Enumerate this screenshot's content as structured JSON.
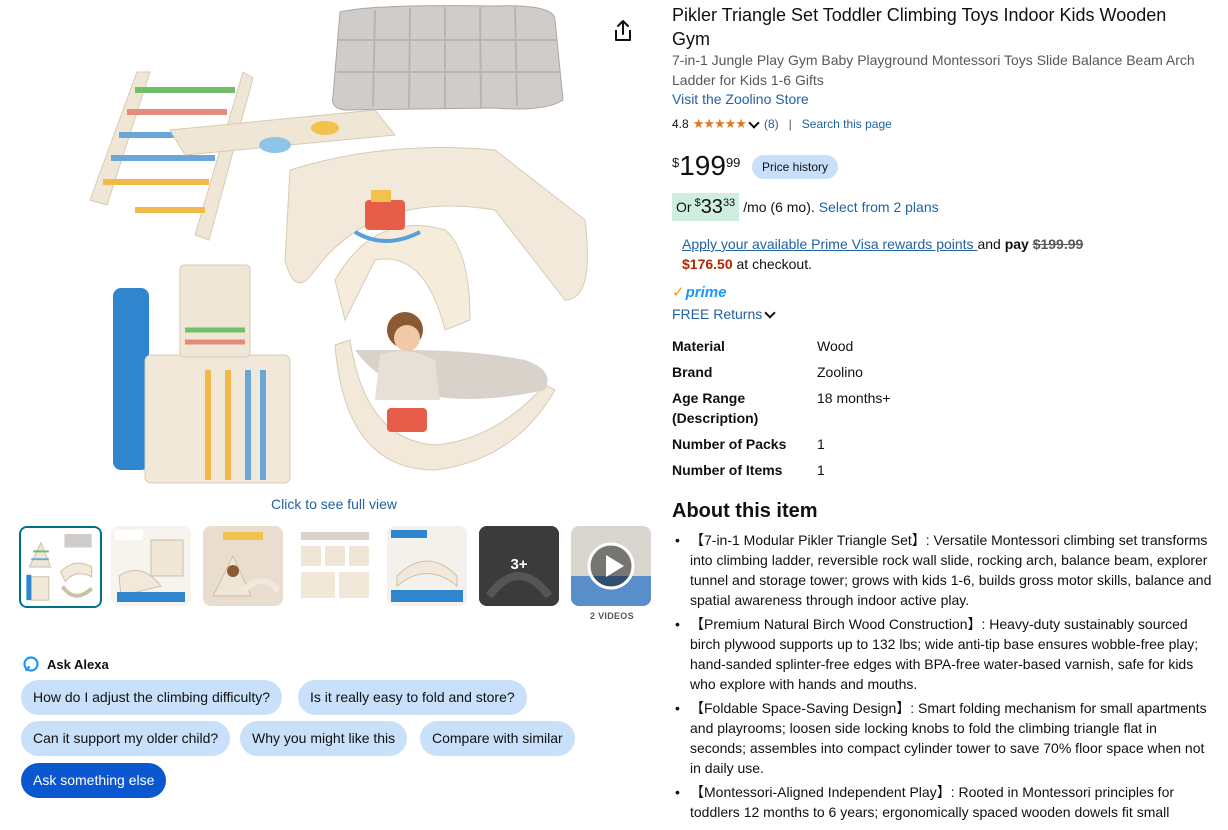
{
  "product": {
    "title": "Pikler Triangle Set Toddler Climbing Toys Indoor Kids Wooden Gym",
    "subtitle": "7-in-1 Jungle Play Gym Baby Playground Montessori Toys Slide Balance Beam Arch Ladder for Kids 1-6 Gifts",
    "store_link": "Visit the Zoolino Store",
    "rating": "4.8",
    "stars": "★★★★★",
    "rating_count": "(8)",
    "search_page": "Search this page"
  },
  "gallery": {
    "full_view": "Click to see full view",
    "more_label": "3+",
    "videos_label": "2 VIDEOS",
    "thumbs": [
      "thumb-1",
      "thumb-2",
      "thumb-3",
      "thumb-4",
      "thumb-5",
      "thumb-6",
      "thumb-7"
    ]
  },
  "alexa": {
    "title": "Ask Alexa",
    "chips": [
      "How do I adjust the climbing difficulty?",
      "Is it really easy to fold and store?",
      "Can it support my older child?",
      "Why you might like this",
      "Compare with similar",
      "Ask something else"
    ]
  },
  "price": {
    "symbol": "$",
    "whole": "199",
    "fraction": "99",
    "history_label": "Price history",
    "monthly_or": "Or",
    "monthly_symbol": "$",
    "monthly_whole": "33",
    "monthly_fraction": "33",
    "monthly_text": "/mo (6 mo).",
    "plans_link": "Select from 2 plans"
  },
  "prime_offer": {
    "link": "Apply your available Prime Visa rewards points ",
    "and": "and ",
    "pay": "pay",
    "old_price": "$199.99",
    "new_price": "$176.50",
    "suffix": " at checkout."
  },
  "shipping": {
    "prime": "prime",
    "free_returns": "FREE Returns"
  },
  "specs": [
    {
      "k": "Material",
      "v": "Wood"
    },
    {
      "k": "Brand",
      "v": "Zoolino"
    },
    {
      "k": "Age Range (Description)",
      "v": "18 months+"
    },
    {
      "k": "Number of Packs",
      "v": "1"
    },
    {
      "k": "Number of Items",
      "v": "1"
    }
  ],
  "about": {
    "title": "About this item",
    "bullets": [
      "【7-in-1 Modular Pikler Triangle Set】: Versatile Montessori climbing set transforms into climbing ladder, reversible rock wall slide, rocking arch, balance beam, explorer tunnel and storage tower; grows with kids 1-6, builds gross motor skills, balance and spatial awareness through indoor active play.",
      "【Premium Natural Birch Wood Construction】: Heavy-duty sustainably sourced birch plywood supports up to 132 lbs; wide anti-tip base ensures wobble-free play; hand-sanded splinter-free edges with BPA-free water-based varnish, safe for kids who explore with hands and mouths.",
      "【Foldable Space-Saving Design】: Smart folding mechanism for small apartments and playrooms; loosen side locking knobs to fold the climbing triangle flat in seconds; assembles into compact cylinder tower to save 70% floor space when not in daily use.",
      "【Montessori-Aligned Independent Play】: Rooted in Montessori principles for toddlers 12 months to 6 years; ergonomically spaced wooden dowels fit small"
    ]
  },
  "colors": {
    "link": "#2162a1",
    "price_red": "#b12704",
    "chip": "#c9e0fb",
    "chip_primary": "#0b57d0",
    "monthly_highlight": "#cfeee0",
    "prime_blue": "#1a98ff",
    "star": "#de7921"
  }
}
